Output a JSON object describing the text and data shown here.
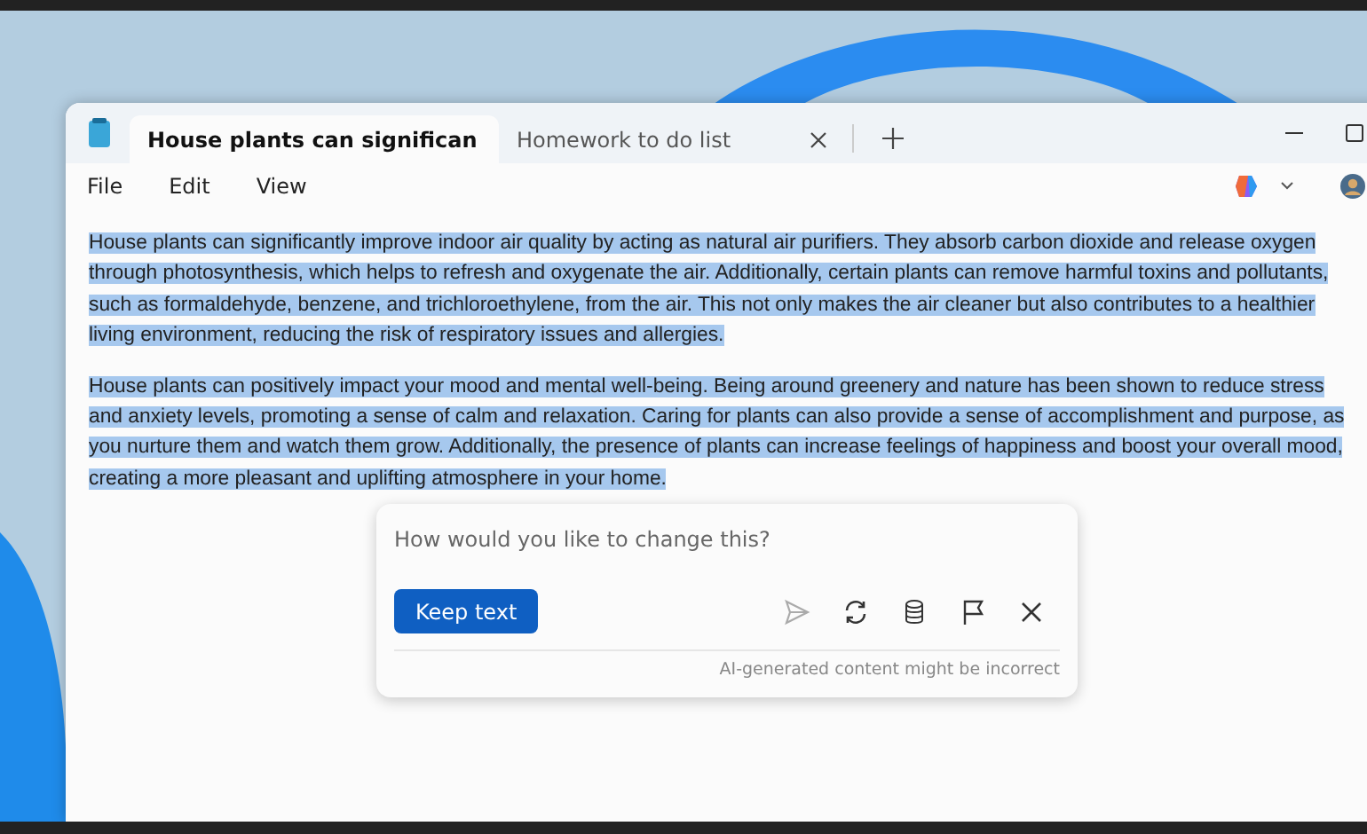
{
  "tabs": [
    {
      "label": "House plants can significan",
      "selected": true
    },
    {
      "label": "Homework to do list",
      "selected": false
    }
  ],
  "menu": [
    "File",
    "Edit",
    "View"
  ],
  "document": {
    "selected": true,
    "paragraphs": [
      "House plants can significantly improve indoor air quality by acting as natural air purifiers. They absorb carbon dioxide and release oxygen through photosynthesis, which helps to refresh and oxygenate the air. Additionally, certain plants can remove harmful toxins and pollutants, such as formaldehyde, benzene, and trichloroethylene, from the air. This not only makes the air cleaner but also contributes to a healthier living environment, reducing the risk of respiratory issues and allergies.",
      "House plants can positively impact your mood and mental well-being. Being around greenery and nature has been shown to reduce stress and anxiety levels, promoting a sense of calm and relaxation. Caring for plants can also provide a sense of accomplishment and purpose, as you nurture them and watch them grow. Additionally, the presence of plants can increase feelings of happiness and boost your overall mood, creating a more pleasant and uplifting atmosphere in your home."
    ]
  },
  "rewrite_panel": {
    "placeholder": "How would you like to change this?",
    "button": "Keep text",
    "send_disabled": true,
    "disclaimer": "AI-generated content might be incorrect"
  }
}
